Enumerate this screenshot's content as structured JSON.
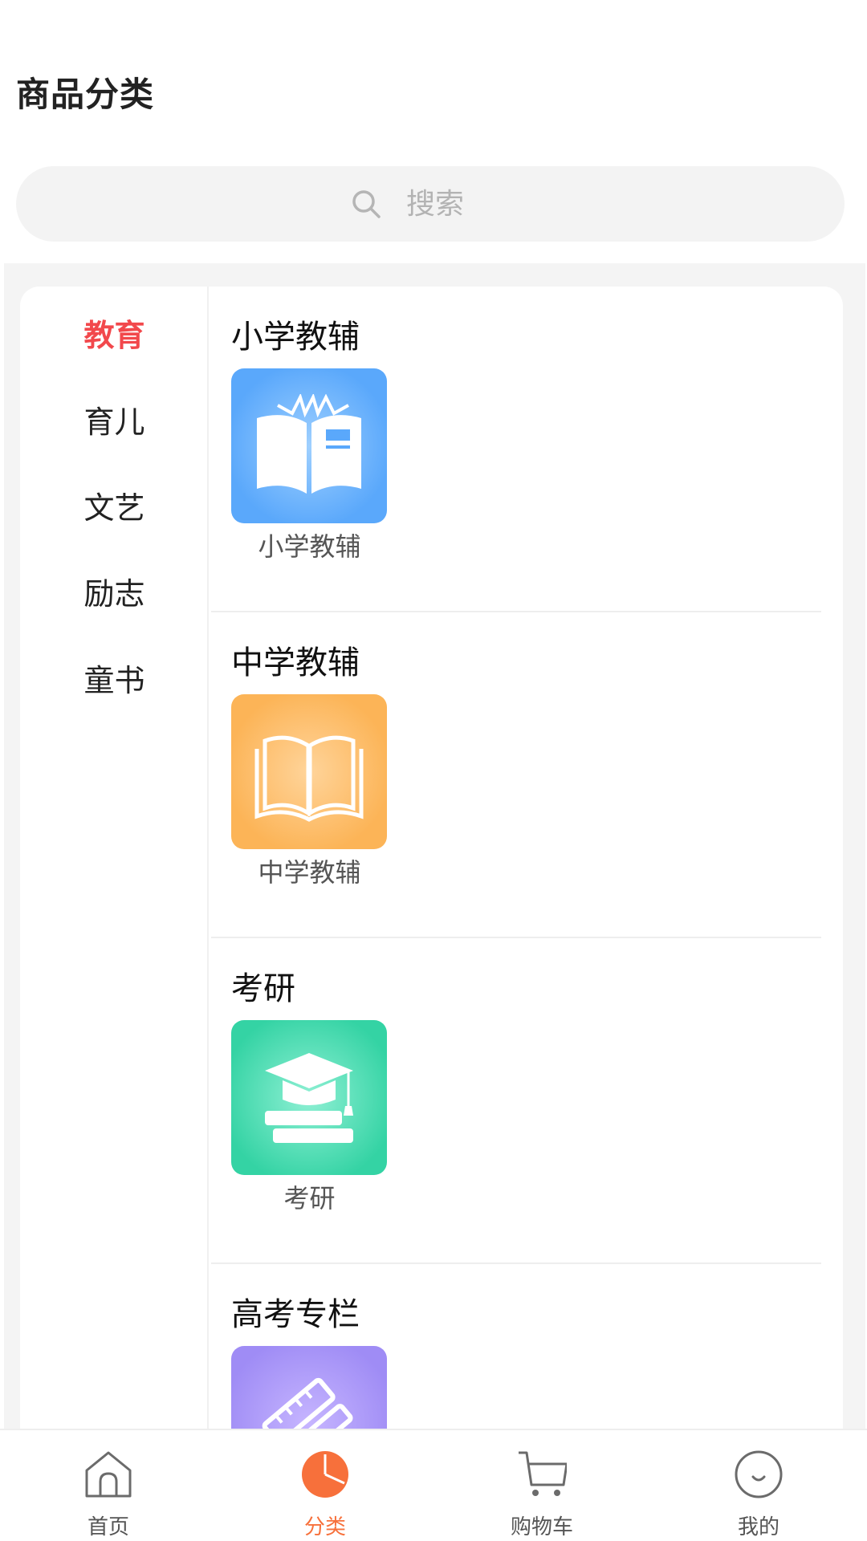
{
  "header": {
    "title": "商品分类"
  },
  "search": {
    "placeholder": "搜索"
  },
  "sidebar": {
    "items": [
      {
        "label": "教育",
        "active": true
      },
      {
        "label": "育儿",
        "active": false
      },
      {
        "label": "文艺",
        "active": false
      },
      {
        "label": "励志",
        "active": false
      },
      {
        "label": "童书",
        "active": false
      }
    ]
  },
  "sections": [
    {
      "title": "小学教辅",
      "items": [
        {
          "label": "小学教辅",
          "icon": "open-book-icon",
          "color": "#5aa8fb"
        }
      ]
    },
    {
      "title": "中学教辅",
      "items": [
        {
          "label": "中学教辅",
          "icon": "book-outline-icon",
          "color": "#fcb457"
        }
      ]
    },
    {
      "title": "考研",
      "items": [
        {
          "label": "考研",
          "icon": "graduation-cap-icon",
          "color": "#34d3a4"
        }
      ]
    },
    {
      "title": "高考专栏",
      "items": [
        {
          "label": "",
          "icon": "ruler-pencil-icon",
          "color": "#9f8cf5"
        }
      ]
    }
  ],
  "tabbar": {
    "active_color": "#f7703b",
    "items": [
      {
        "label": "首页",
        "icon": "home-icon",
        "active": false
      },
      {
        "label": "分类",
        "icon": "pie-chart-icon",
        "active": true
      },
      {
        "label": "购物车",
        "icon": "cart-icon",
        "active": false
      },
      {
        "label": "我的",
        "icon": "smiley-icon",
        "active": false
      }
    ]
  }
}
